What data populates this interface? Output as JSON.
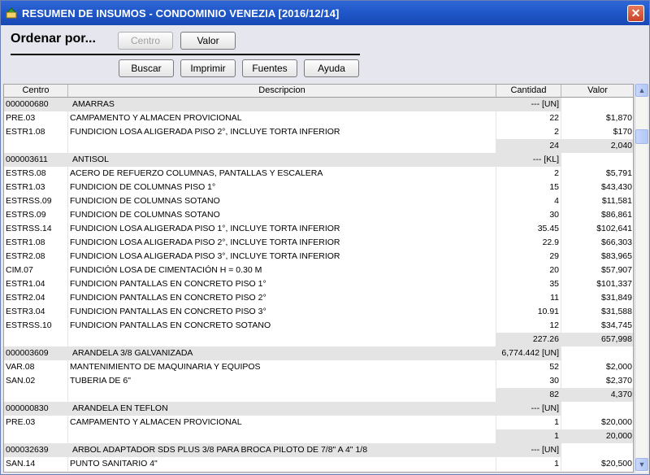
{
  "window": {
    "title": "RESUMEN DE INSUMOS - CONDOMINIO VENEZIA [2016/12/14]",
    "close_glyph": "✕"
  },
  "toolbar": {
    "ordenar_label": "Ordenar por...",
    "centro_label": "Centro",
    "valor_label": "Valor",
    "buscar_label": "Buscar",
    "imprimir_label": "Imprimir",
    "fuentes_label": "Fuentes",
    "ayuda_label": "Ayuda"
  },
  "table": {
    "headers": [
      "Centro",
      "Descripcion",
      "Cantidad",
      "Valor"
    ],
    "rows": [
      {
        "type": "group",
        "c1": "000000680",
        "c2": "AMARRAS",
        "c3": "--- [UN]",
        "c4": ""
      },
      {
        "type": "item",
        "c1": "PRE.03",
        "c2": "CAMPAMENTO Y ALMACEN PROVICIONAL",
        "c3": "22",
        "c4": "$1,870"
      },
      {
        "type": "item",
        "c1": "ESTR1.08",
        "c2": "FUNDICION LOSA ALIGERADA PISO 2°, INCLUYE TORTA INFERIOR",
        "c3": "2",
        "c4": "$170"
      },
      {
        "type": "total",
        "c1": "",
        "c2": "",
        "c3": "24",
        "c4": "2,040"
      },
      {
        "type": "group",
        "c1": "000003611",
        "c2": "ANTISOL",
        "c3": "--- [KL]",
        "c4": ""
      },
      {
        "type": "item",
        "c1": "ESTRS.08",
        "c2": "ACERO DE REFUERZO COLUMNAS, PANTALLAS Y ESCALERA",
        "c3": "2",
        "c4": "$5,791"
      },
      {
        "type": "item",
        "c1": "ESTR1.03",
        "c2": "FUNDICION DE COLUMNAS PISO 1°",
        "c3": "15",
        "c4": "$43,430"
      },
      {
        "type": "item",
        "c1": "ESTRSS.09",
        "c2": "FUNDICION DE COLUMNAS SOTANO",
        "c3": "4",
        "c4": "$11,581"
      },
      {
        "type": "item",
        "c1": "ESTRS.09",
        "c2": "FUNDICION DE COLUMNAS SOTANO",
        "c3": "30",
        "c4": "$86,861"
      },
      {
        "type": "item",
        "c1": "ESTRSS.14",
        "c2": "FUNDICION LOSA ALIGERADA PISO 1°, INCLUYE TORTA INFERIOR",
        "c3": "35.45",
        "c4": "$102,641"
      },
      {
        "type": "item",
        "c1": "ESTR1.08",
        "c2": "FUNDICION LOSA ALIGERADA PISO 2°, INCLUYE TORTA INFERIOR",
        "c3": "22.9",
        "c4": "$66,303"
      },
      {
        "type": "item",
        "c1": "ESTR2.08",
        "c2": "FUNDICION LOSA ALIGERADA PISO 3°, INCLUYE TORTA INFERIOR",
        "c3": "29",
        "c4": "$83,965"
      },
      {
        "type": "item",
        "c1": "CIM.07",
        "c2": "FUNDICIÓN LOSA DE CIMENTACIÓN H = 0.30 M",
        "c3": "20",
        "c4": "$57,907"
      },
      {
        "type": "item",
        "c1": "ESTR1.04",
        "c2": "FUNDICION PANTALLAS EN CONCRETO PISO 1°",
        "c3": "35",
        "c4": "$101,337"
      },
      {
        "type": "item",
        "c1": "ESTR2.04",
        "c2": "FUNDICION PANTALLAS EN CONCRETO PISO 2°",
        "c3": "11",
        "c4": "$31,849"
      },
      {
        "type": "item",
        "c1": "ESTR3.04",
        "c2": "FUNDICION PANTALLAS EN CONCRETO PISO 3°",
        "c3": "10.91",
        "c4": "$31,588"
      },
      {
        "type": "item",
        "c1": "ESTRSS.10",
        "c2": "FUNDICION PANTALLAS EN CONCRETO SOTANO",
        "c3": "12",
        "c4": "$34,745"
      },
      {
        "type": "total",
        "c1": "",
        "c2": "",
        "c3": "227.26",
        "c4": "657,998"
      },
      {
        "type": "group",
        "c1": "000003609",
        "c2": "ARANDELA 3/8 GALVANIZADA",
        "c3": "6,774.442 [UN]",
        "c4": ""
      },
      {
        "type": "item",
        "c1": "VAR.08",
        "c2": "MANTENIMIENTO DE MAQUINARIA Y EQUIPOS",
        "c3": "52",
        "c4": "$2,000"
      },
      {
        "type": "item",
        "c1": "SAN.02",
        "c2": "TUBERIA DE 6\"",
        "c3": "30",
        "c4": "$2,370"
      },
      {
        "type": "total",
        "c1": "",
        "c2": "",
        "c3": "82",
        "c4": "4,370"
      },
      {
        "type": "group",
        "c1": "000000830",
        "c2": "ARANDELA EN TEFLON",
        "c3": "--- [UN]",
        "c4": ""
      },
      {
        "type": "item",
        "c1": "PRE.03",
        "c2": "CAMPAMENTO Y ALMACEN PROVICIONAL",
        "c3": "1",
        "c4": "$20,000"
      },
      {
        "type": "total",
        "c1": "",
        "c2": "",
        "c3": "1",
        "c4": "20,000"
      },
      {
        "type": "group",
        "c1": "000032639",
        "c2": "ARBOL ADAPTADOR SDS PLUS 3/8 PARA BROCA PILOTO DE 7/8\"  A 4\" 1/8",
        "c3": "--- [UN]",
        "c4": ""
      },
      {
        "type": "item",
        "c1": "SAN.14",
        "c2": "PUNTO SANITARIO 4\"",
        "c3": "1",
        "c4": "$20,500"
      }
    ]
  },
  "scrollbar": {
    "up_glyph": "▲",
    "down_glyph": "▼"
  }
}
